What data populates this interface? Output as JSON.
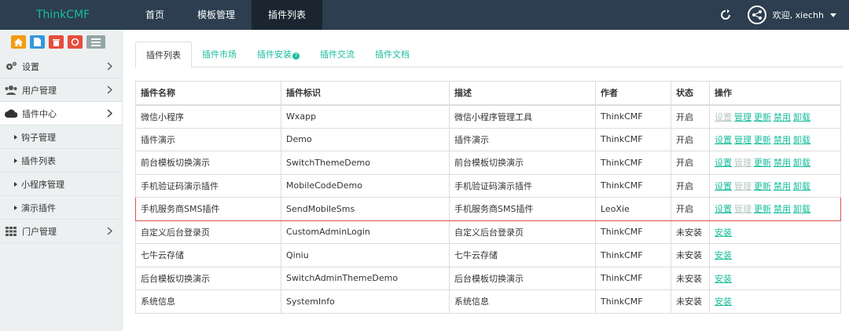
{
  "brand": "ThinkCMF",
  "topnav": [
    "首页",
    "模板管理",
    "插件列表"
  ],
  "user": {
    "welcome": "欢迎, xiechh"
  },
  "sidebar": {
    "items": [
      {
        "label": "设置",
        "icon": "gear-icon"
      },
      {
        "label": "用户管理",
        "icon": "users-icon"
      },
      {
        "label": "插件中心",
        "icon": "cloud-icon"
      },
      {
        "label": "钩子管理"
      },
      {
        "label": "插件列表"
      },
      {
        "label": "小程序管理"
      },
      {
        "label": "演示插件"
      },
      {
        "label": "门户管理",
        "icon": "grid-icon"
      }
    ]
  },
  "tabs": [
    "插件列表",
    "插件市场",
    "插件安装",
    "插件交流",
    "插件文档"
  ],
  "table": {
    "headers": [
      "插件名称",
      "插件标识",
      "描述",
      "作者",
      "状态",
      "操作"
    ],
    "rows": [
      [
        "微信小程序",
        "Wxapp",
        "微信小程序管理工具",
        "ThinkCMF",
        "开启"
      ],
      [
        "插件演示",
        "Demo",
        "插件演示",
        "ThinkCMF",
        "开启"
      ],
      [
        "前台模板切换演示",
        "SwitchThemeDemo",
        "前台模板切换演示",
        "ThinkCMF",
        "开启"
      ],
      [
        "手机验证码演示插件",
        "MobileCodeDemo",
        "手机验证码演示插件",
        "ThinkCMF",
        "开启"
      ],
      [
        "手机服务商SMS插件",
        "SendMobileSms",
        "手机服务商SMS插件",
        "LeoXie",
        "开启"
      ],
      [
        "自定义后台登录页",
        "CustomAdminLogin",
        "自定义后台登录页",
        "ThinkCMF",
        "未安装"
      ],
      [
        "七牛云存储",
        "Qiniu",
        "七牛云存储",
        "ThinkCMF",
        "未安装"
      ],
      [
        "后台模板切换演示",
        "SwitchAdminThemeDemo",
        "后台模板切换演示",
        "ThinkCMF",
        "未安装"
      ],
      [
        "系统信息",
        "SystemInfo",
        "系统信息",
        "ThinkCMF",
        "未安装"
      ]
    ],
    "actions": {
      "settings": "设置",
      "manage": "管理",
      "update": "更新",
      "disable": "禁用",
      "uninstall": "卸载",
      "install": "安装"
    }
  },
  "colors": {
    "navbar": "#2c3e50",
    "accent": "#18bc9c",
    "sidebar": "#ecf0f1",
    "highlight": "#d9534f"
  }
}
